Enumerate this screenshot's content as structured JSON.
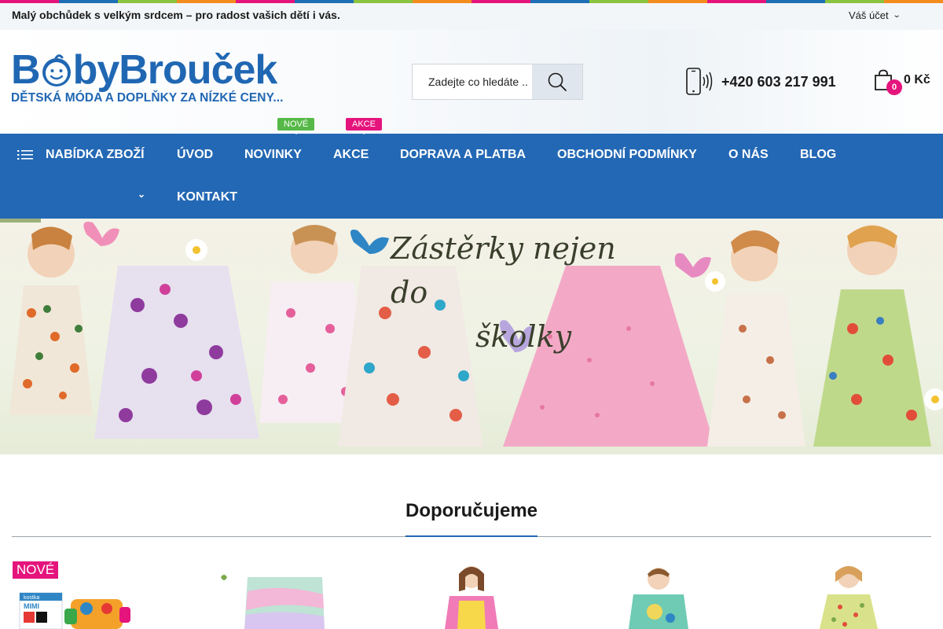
{
  "colors": {
    "brand_blue": "#2368b4",
    "pink": "#e5147c",
    "green": "#56b947",
    "stripe": [
      "#e5147c",
      "#1e6fb5",
      "#8ac43f",
      "#f28c1e",
      "#e5147c",
      "#1e6fb5",
      "#8ac43f",
      "#f28c1e",
      "#e5147c",
      "#1e6fb5",
      "#8ac43f",
      "#f28c1e",
      "#e5147c",
      "#1e6fb5",
      "#8ac43f",
      "#f28c1e"
    ]
  },
  "topbar": {
    "tagline": "Malý obchůdek s velkým srdcem – pro radost vašich dětí i vás.",
    "account_label": "Váš účet",
    "account_icon": "chevron-down-icon"
  },
  "header": {
    "logo": {
      "word_1": "B",
      "word_2": "by",
      "word_3": "Brouček",
      "slogan": "DĚTSKÁ MÓDA A DOPLŇKY ZA NÍZKÉ CENY..."
    },
    "search": {
      "placeholder": "Zadejte co hledáte ..",
      "icon": "search-icon"
    },
    "phone": {
      "number": "+420 603 217 991",
      "icon": "phone-icon"
    },
    "cart": {
      "count": "0",
      "total": "0 Kč",
      "icon": "shopping-bag-icon"
    }
  },
  "nav": {
    "catalog_label": "NABÍDKA ZBOŽÍ",
    "catalog_icon": "list-icon",
    "items": [
      {
        "label": "ÚVOD"
      },
      {
        "label": "NOVINKY",
        "tag": "NOVÉ"
      },
      {
        "label": "AKCE",
        "tag": "AKCE"
      },
      {
        "label": "DOPRAVA A PLATBA"
      },
      {
        "label": "OBCHODNÍ PODMÍNKY"
      },
      {
        "label": "O NÁS"
      },
      {
        "label": "BLOG"
      },
      {
        "label": "KONTAKT"
      }
    ]
  },
  "banner": {
    "title_line_1": "Zástěrky nejen do",
    "title_line_2": "školky"
  },
  "recommended": {
    "title": "Doporučujeme",
    "new_badge": "NOVÉ",
    "product_1_box_line_1": "kostka",
    "product_1_box_line_2": "MIMI"
  }
}
